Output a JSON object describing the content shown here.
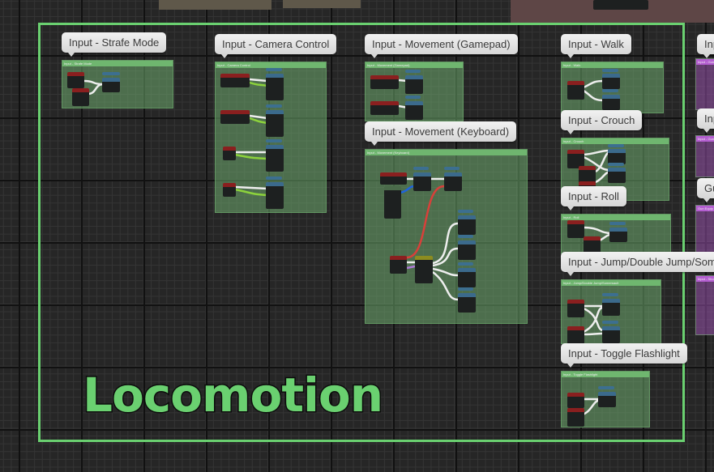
{
  "canvas": {
    "group_title": "Locomotion",
    "frame_color": "#6ad070",
    "comment_color": "#6fb66f",
    "other_group_color": "#b45ed0"
  },
  "comments": [
    {
      "id": "strafe",
      "label": "Input - Strafe Mode",
      "header": "Input - Strafe Mode"
    },
    {
      "id": "camera",
      "label": "Input - Camera Control",
      "header": "Input - Camera Control"
    },
    {
      "id": "gamepad",
      "label": "Input - Movement (Gamepad)",
      "header": "Input - Movement (Gamepad)"
    },
    {
      "id": "keyboard",
      "label": "Input - Movement (Keyboard)",
      "header": "Input - Movement (Keyboard)"
    },
    {
      "id": "walk",
      "label": "Input - Walk",
      "header": "Input - Walk"
    },
    {
      "id": "crouch",
      "label": "Input - Crouch",
      "header": "Input - Crouch"
    },
    {
      "id": "roll",
      "label": "Input - Roll",
      "header": "Input - Roll"
    },
    {
      "id": "jump",
      "label": "Input - Jump/Double Jump/Somersault",
      "header": "Input - Jump/Double Jump/Somersault"
    },
    {
      "id": "flashlight",
      "label": "Input - Toggle Flashlight",
      "header": "Input - Toggle Flashlight"
    }
  ],
  "side_comments": [
    {
      "label": "Inp",
      "header": "Input - Gun E"
    },
    {
      "label": "Inp",
      "header": "Input - Gun E"
    },
    {
      "label": "Gu",
      "header": "Gun Equip /"
    },
    {
      "label": "Inp",
      "header": "Input - Shoot"
    }
  ]
}
